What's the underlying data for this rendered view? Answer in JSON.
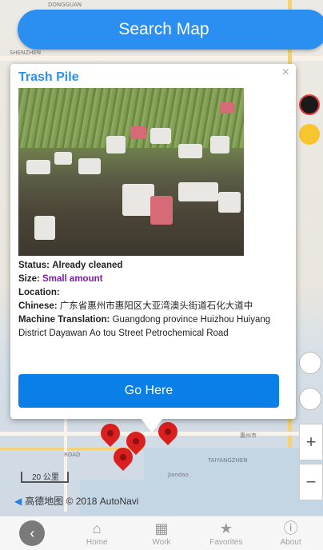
{
  "search": {
    "label": "Search Map"
  },
  "popup": {
    "title": "Trash Pile",
    "close": "×",
    "status_label": "Status:",
    "status_value": "Already cleaned",
    "size_label": "Size:",
    "size_value": "Small amount",
    "location_label": "Location:",
    "chinese_label": "Chinese:",
    "chinese_value": "广东省惠州市惠阳区大亚湾澳头街道石化大道中",
    "translation_label": "Machine Translation:",
    "translation_value": "Guangdong province Huizhou Huiyang District Dayawan Ao tou Street Petrochemical Road",
    "go_button": "Go Here"
  },
  "map": {
    "scale": "20 公里",
    "attribution": "高德地图 © 2018 AutoNavi",
    "zoom_in": "+",
    "zoom_out": "−"
  },
  "nav": {
    "back_icon": "‹",
    "items": [
      {
        "label": "Home",
        "icon": "home-icon"
      },
      {
        "label": "Work",
        "icon": "building-icon"
      },
      {
        "label": "Favorites",
        "icon": "star-icon"
      },
      {
        "label": "About",
        "icon": "info-icon"
      }
    ]
  },
  "colors": {
    "accent": "#2a8ff0",
    "go": "#0b7fe8",
    "size": "#7b1fa2",
    "pin": "#d9201f"
  }
}
